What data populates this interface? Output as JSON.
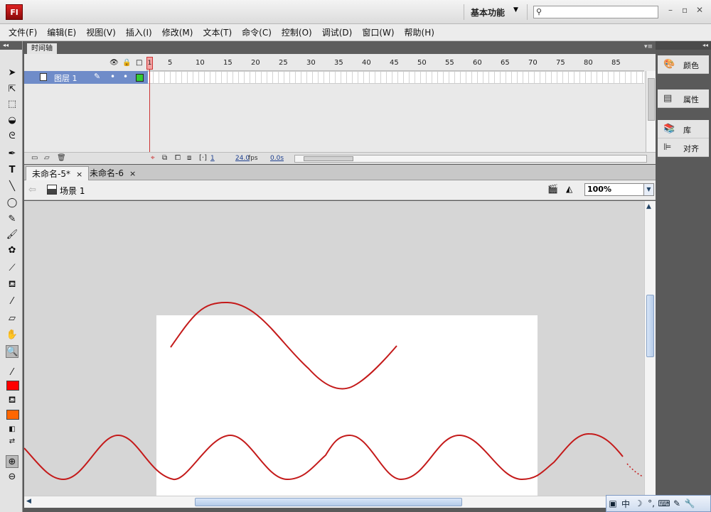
{
  "app": {
    "logo": "Fl",
    "workspace": "基本功能",
    "workspace_arrow": "▼"
  },
  "menu": [
    "文件(F)",
    "编辑(E)",
    "视图(V)",
    "插入(I)",
    "修改(M)",
    "文本(T)",
    "命令(C)",
    "控制(O)",
    "调试(D)",
    "窗口(W)",
    "帮助(H)"
  ],
  "timeline": {
    "tab": "时间轴",
    "frame_numbers": [
      "1",
      "5",
      "10",
      "15",
      "20",
      "25",
      "30",
      "35",
      "40",
      "45",
      "50",
      "55",
      "60",
      "65",
      "70",
      "75",
      "80",
      "85"
    ],
    "layer_name": "图层 1",
    "current_frame": "1",
    "fps": "24.0",
    "fps_unit": "fps",
    "time": "0.0s"
  },
  "documents": {
    "tabs": [
      {
        "label": "未命名-5*",
        "close": "×"
      },
      {
        "label": "未命名-6",
        "close": "×"
      }
    ]
  },
  "editbar": {
    "scene": "场景 1",
    "zoom": "100%"
  },
  "right_panel": {
    "items": [
      {
        "label": "颜色",
        "icon": "palette-icon"
      },
      {
        "label": "属性",
        "icon": "properties-icon"
      },
      {
        "label": "库",
        "icon": "library-icon"
      },
      {
        "label": "对齐",
        "icon": "align-icon"
      }
    ]
  },
  "colors": {
    "stroke": "#ff0000",
    "fill": "#ff6600",
    "curve": "#c41a1a"
  },
  "ime": [
    "中",
    "☽",
    "°,",
    "⌨",
    "✎",
    "🔧"
  ]
}
